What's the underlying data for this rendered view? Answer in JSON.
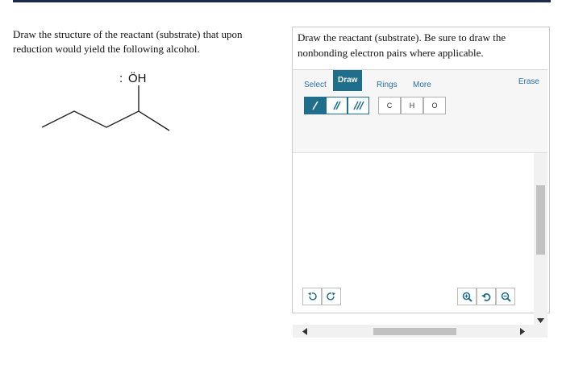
{
  "question": {
    "text": "Draw the structure of the reactant (substrate) that upon reduction would yield the following alcohol."
  },
  "molecule": {
    "oh_label": "ÖH",
    "lone_pair": ":"
  },
  "panel": {
    "prompt": "Draw the reactant (substrate). Be sure to draw the nonbonding electron pairs where applicable.",
    "tabs": [
      {
        "label": "Select"
      },
      {
        "label": "Draw"
      },
      {
        "label": "Rings"
      },
      {
        "label": "More"
      }
    ],
    "erase_label": "Erase",
    "atoms": [
      "C",
      "H",
      "O"
    ],
    "bond_tools": [
      "single-bond",
      "double-bond",
      "triple-bond"
    ]
  },
  "colors": {
    "accent": "#1f6e8c",
    "link": "#2a6ea8"
  }
}
